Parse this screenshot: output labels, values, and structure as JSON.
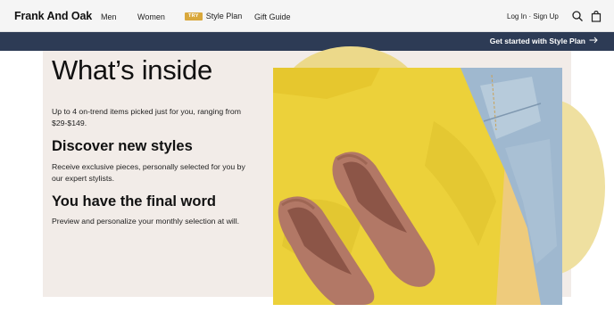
{
  "nav": {
    "brand": "Frank And Oak",
    "items": [
      {
        "label": "Men"
      },
      {
        "label": "Women"
      },
      {
        "label": "Style Plan",
        "badge": "TRY"
      },
      {
        "label": "Gift Guide"
      }
    ],
    "account_label": "Log In · Sign Up",
    "icons": [
      "search-icon",
      "shopping-bag-icon"
    ]
  },
  "banner": {
    "cta_label": "Get started with Style Plan",
    "cta_icon": "arrow-right-icon",
    "color": "#2d3b55"
  },
  "content": {
    "title": "What’s inside",
    "intro": "Up to 4 on-trend items picked just for you, ranging from $29-$149.",
    "section1": {
      "heading": "Discover new styles",
      "body": "Receive exclusive pieces, personally selected for you by our expert stylists."
    },
    "section2": {
      "heading": "You have the final word",
      "body": "Preview and personalize your monthly selection at will."
    }
  },
  "colors": {
    "accent_badge": "#d9a83c",
    "panel_background": "#f2ece8",
    "blob": "#ecd98a"
  }
}
